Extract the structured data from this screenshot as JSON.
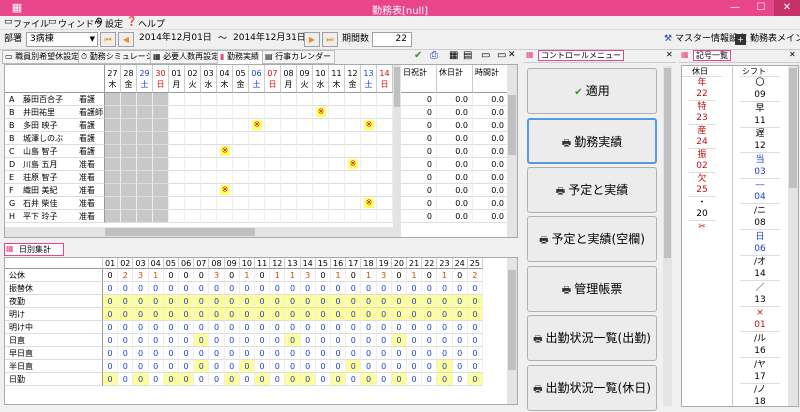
{
  "window": {
    "title": "勤務表[null]",
    "min": "—",
    "max": "☐",
    "close": "✕"
  },
  "menu": [
    {
      "label": "ファイル"
    },
    {
      "label": "ウィンドウ"
    },
    {
      "label": "設定"
    },
    {
      "label": "ヘルプ"
    }
  ],
  "toolbar": {
    "dept_label": "部署",
    "dept_value": "3病棟",
    "date_from": "2014年12月01日",
    "tilde": "～",
    "date_to": "2014年12月31日",
    "period_label": "期間数",
    "period_value": "22",
    "master_label": "マスター情報設定",
    "main_label": "勤務表メイン"
  },
  "tabs": [
    {
      "label": "職員別希望休設定"
    },
    {
      "label": "勤務シミュレーション"
    },
    {
      "label": "必要人数再設定"
    },
    {
      "label": "勤務実績"
    },
    {
      "label": "行事カレンダー"
    }
  ],
  "schedule": {
    "days": [
      {
        "d": "27",
        "w": "木",
        "c": "#000"
      },
      {
        "d": "28",
        "w": "金",
        "c": "#000"
      },
      {
        "d": "29",
        "w": "土",
        "c": "#1a3fd0"
      },
      {
        "d": "30",
        "w": "日",
        "c": "#d01010"
      },
      {
        "d": "01",
        "w": "月",
        "c": "#000"
      },
      {
        "d": "02",
        "w": "火",
        "c": "#000"
      },
      {
        "d": "03",
        "w": "水",
        "c": "#000"
      },
      {
        "d": "04",
        "w": "木",
        "c": "#000"
      },
      {
        "d": "05",
        "w": "金",
        "c": "#000"
      },
      {
        "d": "06",
        "w": "土",
        "c": "#1a3fd0"
      },
      {
        "d": "07",
        "w": "日",
        "c": "#d01010"
      },
      {
        "d": "08",
        "w": "月",
        "c": "#000"
      },
      {
        "d": "09",
        "w": "火",
        "c": "#000"
      },
      {
        "d": "10",
        "w": "水",
        "c": "#000"
      },
      {
        "d": "11",
        "w": "木",
        "c": "#000"
      },
      {
        "d": "12",
        "w": "金",
        "c": "#000"
      },
      {
        "d": "13",
        "w": "土",
        "c": "#1a3fd0"
      },
      {
        "d": "14",
        "w": "日",
        "c": "#d01010"
      }
    ],
    "staff": [
      {
        "g": "A",
        "name": "藤田百合子",
        "role": "看護"
      },
      {
        "g": "B",
        "name": "井田祐里",
        "role": "看護師"
      },
      {
        "g": "B",
        "name": "多田 映子",
        "role": "看護"
      },
      {
        "g": "B",
        "name": "城澤しのぶ",
        "role": "看護"
      },
      {
        "g": "C",
        "name": "山島 智子",
        "role": "看護"
      },
      {
        "g": "D",
        "name": "川島 五月",
        "role": "准看"
      },
      {
        "g": "E",
        "name": "荘原 智子",
        "role": "准看"
      },
      {
        "g": "F",
        "name": "織田 美紀",
        "role": "准看"
      },
      {
        "g": "G",
        "name": "石井 柴佳",
        "role": "准看"
      },
      {
        "g": "H",
        "name": "平下 玲子",
        "role": "准看"
      }
    ],
    "marks": [
      [
        1,
        13
      ],
      [
        2,
        9
      ],
      [
        2,
        16
      ],
      [
        4,
        7
      ],
      [
        5,
        15
      ],
      [
        7,
        7
      ],
      [
        8,
        16
      ]
    ],
    "mark_symbol": "※",
    "sum_headers": [
      "日祝計",
      "休日計",
      "時間計"
    ],
    "sum_rows": [
      [
        "0",
        "0.0",
        "0.0"
      ],
      [
        "0",
        "0.0",
        "0.0"
      ],
      [
        "0",
        "0.0",
        "0.0"
      ],
      [
        "0",
        "0.0",
        "0.0"
      ],
      [
        "0",
        "0.0",
        "0.0"
      ],
      [
        "0",
        "0.0",
        "0.0"
      ],
      [
        "0",
        "0.0",
        "0.0"
      ],
      [
        "0",
        "0.0",
        "0.0"
      ],
      [
        "0",
        "0.0",
        "0.0"
      ],
      [
        "0",
        "0.0",
        "0.0"
      ]
    ]
  },
  "daily": {
    "title": "日別集計",
    "cols": [
      "01",
      "02",
      "03",
      "04",
      "05",
      "06",
      "07",
      "08",
      "09",
      "10",
      "11",
      "12",
      "13",
      "14",
      "15",
      "16",
      "17",
      "18",
      "19",
      "20",
      "21",
      "22",
      "23",
      "24",
      "25"
    ],
    "rows": [
      {
        "label": "公休",
        "values": [
          "0",
          "2",
          "3",
          "1",
          "0",
          "0",
          "0",
          "3",
          "0",
          "1",
          "0",
          "1",
          "1",
          "3",
          "0",
          "1",
          "0",
          "1",
          "3",
          "0",
          "1",
          "0",
          "1",
          "0",
          "2"
        ]
      },
      {
        "label": "振替休",
        "values": [
          "0",
          "0",
          "0",
          "0",
          "0",
          "0",
          "0",
          "0",
          "0",
          "0",
          "0",
          "0",
          "0",
          "0",
          "0",
          "0",
          "0",
          "0",
          "0",
          "0",
          "0",
          "0",
          "0",
          "0",
          "0"
        ]
      },
      {
        "label": "夜勤",
        "values": [
          "0",
          "0",
          "0",
          "0",
          "0",
          "0",
          "0",
          "0",
          "0",
          "0",
          "0",
          "0",
          "0",
          "0",
          "0",
          "0",
          "0",
          "0",
          "0",
          "0",
          "0",
          "0",
          "0",
          "0",
          "0"
        ]
      },
      {
        "label": "明け",
        "values": [
          "0",
          "0",
          "0",
          "0",
          "0",
          "0",
          "0",
          "0",
          "0",
          "0",
          "0",
          "0",
          "0",
          "0",
          "0",
          "0",
          "0",
          "0",
          "0",
          "0",
          "0",
          "0",
          "0",
          "0",
          "0"
        ]
      },
      {
        "label": "明け中",
        "values": [
          "0",
          "0",
          "0",
          "0",
          "0",
          "0",
          "0",
          "0",
          "0",
          "0",
          "0",
          "0",
          "0",
          "0",
          "0",
          "0",
          "0",
          "0",
          "0",
          "0",
          "0",
          "0",
          "0",
          "0",
          "0"
        ]
      },
      {
        "label": "日直",
        "values": [
          "0",
          "0",
          "0",
          "0",
          "0",
          "0",
          "0",
          "0",
          "0",
          "0",
          "0",
          "0",
          "0",
          "0",
          "0",
          "0",
          "0",
          "0",
          "0",
          "0",
          "0",
          "0",
          "0",
          "0",
          "0"
        ]
      },
      {
        "label": "早日直",
        "values": [
          "0",
          "0",
          "0",
          "0",
          "0",
          "0",
          "0",
          "0",
          "0",
          "0",
          "0",
          "0",
          "0",
          "0",
          "0",
          "0",
          "0",
          "0",
          "0",
          "0",
          "0",
          "0",
          "0",
          "0",
          "0"
        ]
      },
      {
        "label": "半日直",
        "values": [
          "0",
          "0",
          "0",
          "0",
          "0",
          "0",
          "0",
          "0",
          "0",
          "0",
          "0",
          "0",
          "0",
          "0",
          "0",
          "0",
          "0",
          "0",
          "0",
          "0",
          "0",
          "0",
          "0",
          "0",
          "0"
        ]
      },
      {
        "label": "日勤",
        "values": [
          "0",
          "0",
          "0",
          "0",
          "0",
          "0",
          "0",
          "0",
          "0",
          "0",
          "0",
          "0",
          "0",
          "0",
          "0",
          "0",
          "0",
          "0",
          "0",
          "0",
          "0",
          "0",
          "0",
          "0",
          "0"
        ]
      }
    ],
    "highlight": [
      [
        0,
        0,
        0,
        0,
        0,
        0,
        0,
        0,
        0,
        0,
        0,
        0,
        0,
        0,
        0,
        0,
        0,
        0,
        0,
        0,
        0,
        0,
        0,
        0,
        0
      ],
      [
        0,
        0,
        0,
        0,
        0,
        0,
        0,
        0,
        0,
        0,
        0,
        0,
        0,
        0,
        0,
        0,
        0,
        0,
        0,
        0,
        0,
        0,
        0,
        0,
        0
      ],
      [
        1,
        1,
        1,
        1,
        1,
        1,
        1,
        1,
        1,
        1,
        1,
        1,
        1,
        1,
        1,
        1,
        1,
        1,
        1,
        1,
        1,
        1,
        1,
        1,
        1
      ],
      [
        1,
        1,
        1,
        1,
        1,
        1,
        1,
        1,
        1,
        1,
        1,
        1,
        1,
        1,
        1,
        1,
        1,
        1,
        1,
        1,
        1,
        1,
        1,
        1,
        1
      ],
      [
        0,
        0,
        0,
        0,
        0,
        0,
        0,
        0,
        0,
        0,
        0,
        0,
        0,
        0,
        0,
        0,
        0,
        0,
        0,
        0,
        0,
        0,
        0,
        0,
        0
      ],
      [
        0,
        0,
        0,
        0,
        0,
        0,
        1,
        0,
        0,
        0,
        0,
        0,
        1,
        0,
        0,
        0,
        0,
        0,
        0,
        1,
        0,
        0,
        0,
        0,
        0
      ],
      [
        0,
        0,
        0,
        0,
        0,
        0,
        0,
        0,
        0,
        0,
        0,
        0,
        0,
        0,
        0,
        0,
        0,
        0,
        0,
        0,
        0,
        0,
        0,
        0,
        0
      ],
      [
        0,
        0,
        0,
        0,
        0,
        0,
        1,
        0,
        0,
        1,
        0,
        0,
        0,
        0,
        0,
        0,
        1,
        0,
        0,
        0,
        0,
        0,
        1,
        0,
        0
      ],
      [
        1,
        0,
        1,
        0,
        1,
        1,
        0,
        0,
        1,
        0,
        1,
        0,
        1,
        1,
        0,
        1,
        0,
        1,
        0,
        1,
        0,
        0,
        1,
        0,
        1
      ]
    ]
  },
  "control": {
    "title": "コントロールメニュー",
    "buttons": [
      {
        "label": "適用",
        "icon": "✔"
      },
      {
        "label": "勤務実績",
        "icon": "🖶"
      },
      {
        "label": "予定と実績",
        "icon": "🖶"
      },
      {
        "label": "予定と実績(空欄)",
        "icon": "🖶"
      },
      {
        "label": "管理帳票",
        "icon": "🖶"
      },
      {
        "label": "出勤状況一覧(出勤)",
        "icon": "🖶"
      },
      {
        "label": "出勤状況一覧(休日)",
        "icon": "🖶"
      }
    ]
  },
  "symbols": {
    "title": "記号一覧",
    "left_header": "休日",
    "right_header": "シフト",
    "left": [
      {
        "s": "年",
        "n": "22",
        "c": "#c01010"
      },
      {
        "s": "特",
        "n": "23",
        "c": "#c01010"
      },
      {
        "s": "産",
        "n": "24",
        "c": "#c01010"
      },
      {
        "s": "振",
        "n": "02",
        "c": "#c01010"
      },
      {
        "s": "欠",
        "n": "25",
        "c": "#c01010"
      },
      {
        "s": "・",
        "n": "20",
        "c": "#000"
      }
    ],
    "right": [
      {
        "s": "〇",
        "n": "09",
        "c": "#000"
      },
      {
        "s": "早",
        "n": "11",
        "c": "#000"
      },
      {
        "s": "遅",
        "n": "12",
        "c": "#000"
      },
      {
        "s": "当",
        "n": "03",
        "c": "#1a3fd0"
      },
      {
        "s": "―",
        "n": "04",
        "c": "#1a3fd0"
      },
      {
        "s": "/ニ",
        "n": "08",
        "c": "#000"
      },
      {
        "s": "日",
        "n": "06",
        "c": "#1a3fd0"
      },
      {
        "s": "/オ",
        "n": "14",
        "c": "#000"
      },
      {
        "s": "／",
        "n": "13",
        "c": "#000"
      },
      {
        "s": "×",
        "n": "01",
        "c": "#c01010"
      },
      {
        "s": "/ル",
        "n": "16",
        "c": "#000"
      },
      {
        "s": "/ヤ",
        "n": "17",
        "c": "#000"
      },
      {
        "s": "/ノ",
        "n": "18",
        "c": "#000"
      }
    ]
  }
}
